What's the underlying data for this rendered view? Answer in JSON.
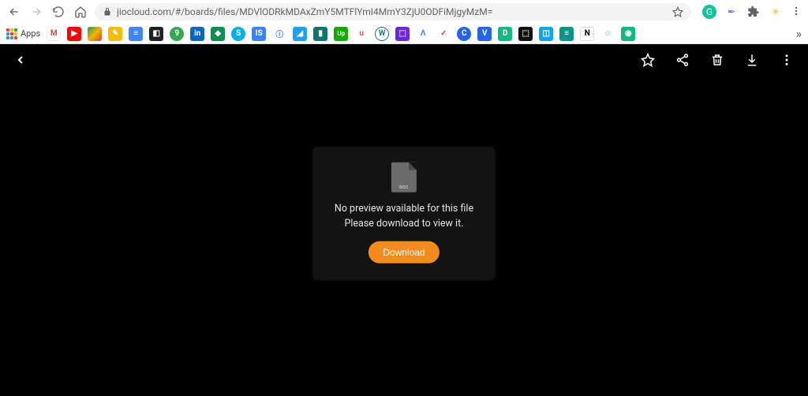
{
  "browser": {
    "url": "jiocloud.com/#/boards/files/MDVlODRkMDAxZmY5MTFlYmI4MmY3ZjU0ODFiMjgyMzM=",
    "apps_label": "Apps"
  },
  "viewer": {
    "file_type_label": "DOC",
    "no_preview_line1": "No preview available for this file",
    "no_preview_line2": "Please download to view it.",
    "download_label": "Download"
  }
}
